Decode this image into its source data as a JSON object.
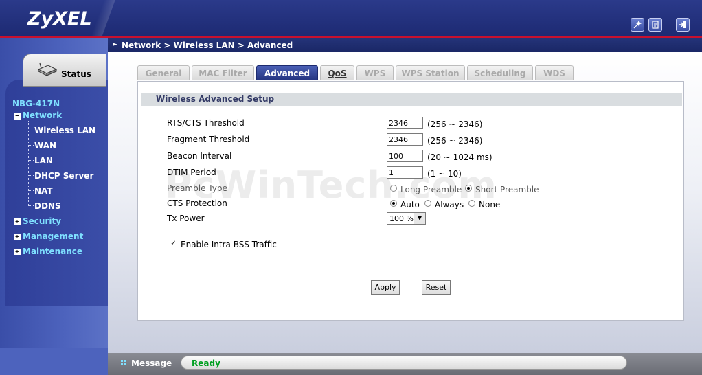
{
  "header": {
    "logo": "ZyXEL",
    "icons": [
      "wizard-icon",
      "about-icon",
      "logout-icon"
    ]
  },
  "breadcrumb": "Network > Wireless LAN > Advanced",
  "sidebar": {
    "status_label": "Status",
    "device": "NBG-417N",
    "tree": [
      {
        "label": "Network",
        "expanded": true,
        "children": [
          "Wireless LAN",
          "WAN",
          "LAN",
          "DHCP Server",
          "NAT",
          "DDNS"
        ]
      },
      {
        "label": "Security",
        "expanded": false
      },
      {
        "label": "Management",
        "expanded": false
      },
      {
        "label": "Maintenance",
        "expanded": false
      }
    ]
  },
  "tabs": [
    {
      "label": "General",
      "active": false
    },
    {
      "label": "MAC Filter",
      "active": false
    },
    {
      "label": "Advanced",
      "active": true
    },
    {
      "label": "QoS",
      "active": false
    },
    {
      "label": "WPS",
      "active": false
    },
    {
      "label": "WPS Station",
      "active": false
    },
    {
      "label": "Scheduling",
      "active": false
    },
    {
      "label": "WDS",
      "active": false
    }
  ],
  "section_title": "Wireless Advanced Setup",
  "fields": {
    "rts": {
      "label": "RTS/CTS Threshold",
      "value": "2346",
      "range": "(256 ~ 2346)"
    },
    "frag": {
      "label": "Fragment Threshold",
      "value": "2346",
      "range": "(256 ~ 2346)"
    },
    "beacon": {
      "label": "Beacon Interval",
      "value": "100",
      "range": "(20 ~ 1024 ms)"
    },
    "dtim": {
      "label": "DTIM Period",
      "value": "1",
      "range": "(1 ~ 10)"
    },
    "preamble": {
      "label": "Preamble Type",
      "options": [
        "Long Preamble",
        "Short Preamble"
      ],
      "selected": "Short Preamble"
    },
    "cts": {
      "label": "CTS Protection",
      "options": [
        "Auto",
        "Always",
        "None"
      ],
      "selected": "Auto"
    },
    "txpower": {
      "label": "Tx Power",
      "value": "100 %"
    }
  },
  "intra_bss": {
    "label": "Enable Intra-BSS Traffic",
    "checked": true
  },
  "buttons": {
    "apply": "Apply",
    "reset": "Reset"
  },
  "watermark": "PcWinTech.com",
  "message": {
    "label": "Message",
    "text": "Ready"
  },
  "colors": {
    "brand": "#1d2a73",
    "accent_red": "#c8102e",
    "ready_green": "#00a020"
  }
}
